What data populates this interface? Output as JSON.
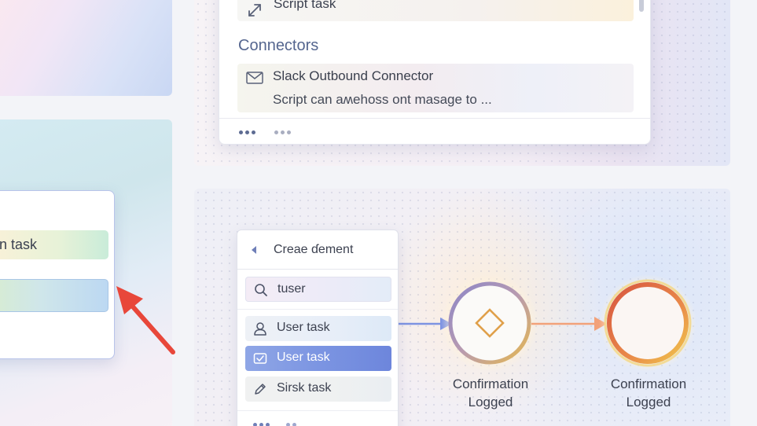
{
  "element_list": {
    "script_task_label": "Script task",
    "connectors_title": "Connectors",
    "slack_title": "Slack Outbound Connector",
    "slack_description": "Script can aʍehoss ont masage to ..."
  },
  "left_popup": {
    "row_label": "en task"
  },
  "create_element": {
    "title": "Creae ɗement",
    "search_value": "tuser",
    "options": [
      {
        "label": "User task",
        "icon": "user-icon",
        "selected": false
      },
      {
        "label": "User task",
        "icon": "envelope-check-icon",
        "selected": true
      },
      {
        "label": "Sirsk task",
        "icon": "pencil-icon",
        "selected": false
      }
    ]
  },
  "flow": {
    "nodes": [
      {
        "label_line1": "Confirmation",
        "label_line2": "Logged",
        "type": "gateway"
      },
      {
        "label_line1": "Confirmation",
        "label_line2": "Logged",
        "type": "end-event"
      }
    ]
  },
  "colors": {
    "accent": "#7c95e2",
    "flow_arrow_in": "#7d93e2",
    "flow_arrow_out": "#f2a179",
    "pointer_arrow": "#e8473a",
    "gateway_diamond": "#e0a04a",
    "end_event_ring": "#d85a3c"
  }
}
